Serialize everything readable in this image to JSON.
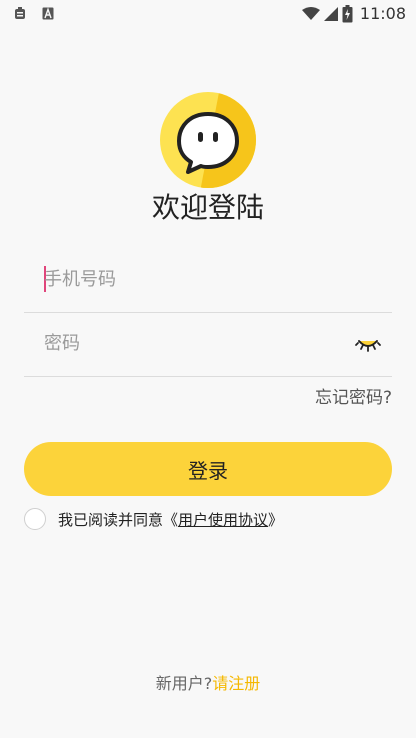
{
  "status_bar": {
    "time": "11:08",
    "left_icons": [
      "notification-icon",
      "a-box-icon"
    ],
    "right_icons": [
      "wifi-icon",
      "signal-icon",
      "battery-charging-icon"
    ]
  },
  "logo": {
    "icon": "chat-bubble-face-icon",
    "colors": {
      "light": "#fde251",
      "dark": "#f6c51b"
    }
  },
  "title": "欢迎登陆",
  "form": {
    "phone_placeholder": "手机号码",
    "phone_value": "",
    "password_placeholder": "密码",
    "password_value": "",
    "password_toggle_icon": "closed-eye-icon"
  },
  "forgot_password": "忘记密码?",
  "login_button": "登录",
  "agreement": {
    "prefix": "我已阅读并同意《",
    "link": "用户使用协议",
    "suffix": "》",
    "checked": false
  },
  "register": {
    "prefix": "新用户?",
    "link": "请注册"
  },
  "colors": {
    "accent": "#fcd33a",
    "link": "#f5b800",
    "caret": "#e0457b",
    "background": "#f8f8f8"
  }
}
